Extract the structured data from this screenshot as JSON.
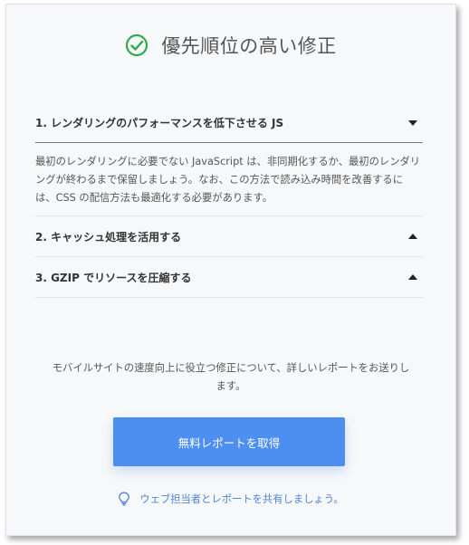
{
  "header": {
    "title": "優先順位の高い修正",
    "icon": "check-circle-icon",
    "icon_color": "#2fa84f"
  },
  "fixes": [
    {
      "title": "1. レンダリングのパフォーマンスを低下させる JS",
      "expanded": true,
      "body": "最初のレンダリングに必要でない JavaScript は、非同期化するか、最初のレンダリングが終わるまで保留しましょう。なお、この方法で読み込み時間を改善するには、CSS の配信方法も最適化する必要があります。"
    },
    {
      "title": "2. キャッシュ処理を活用する",
      "expanded": false
    },
    {
      "title": "3. GZIP でリソースを圧縮する",
      "expanded": false
    }
  ],
  "footer": {
    "note": "モバイルサイトの速度向上に役立つ修正について、詳しいレポートをお送りします。",
    "cta_label": "無料レポートを取得",
    "share_label": "ウェブ担当者とレポートを共有しましょう。",
    "share_icon": "lightbulb-icon"
  },
  "colors": {
    "accent": "#4d8ff1",
    "link": "#4a85d8",
    "success": "#2fa84f"
  }
}
